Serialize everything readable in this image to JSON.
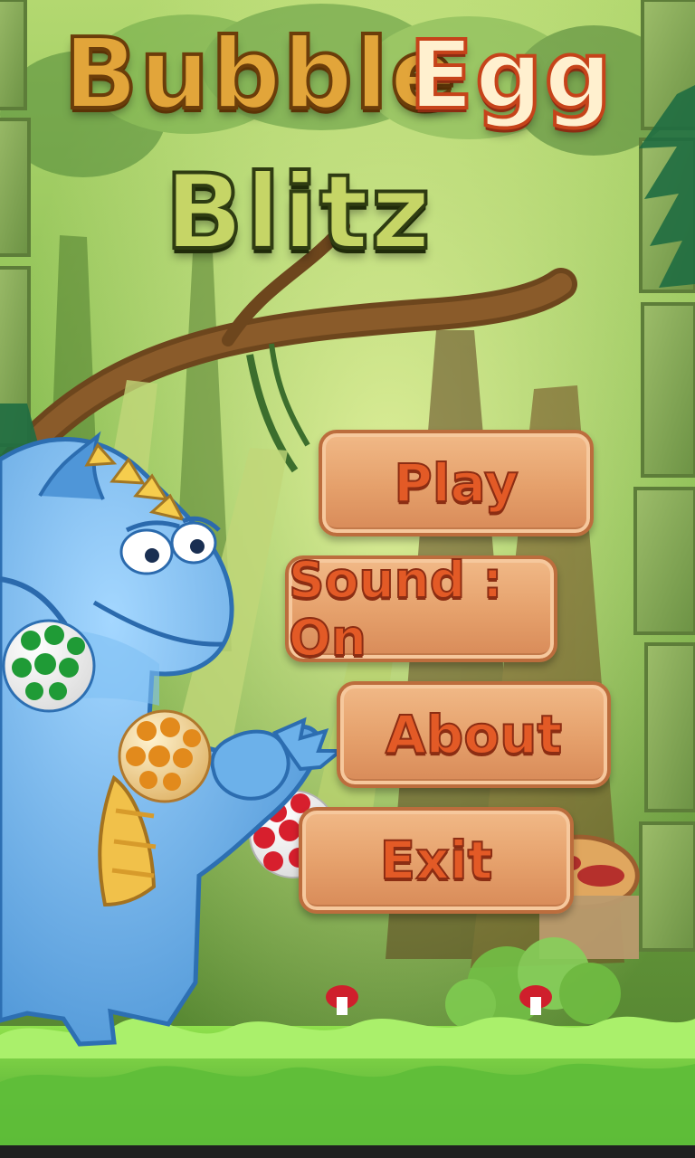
{
  "title": {
    "bubble": "Bubble",
    "egg": "Egg",
    "blitz": "Blitz"
  },
  "menu": {
    "play": "Play",
    "sound": "Sound : On",
    "about": "About",
    "exit": "Exit"
  },
  "colors": {
    "jungle_green": "#5f9233",
    "button_orange": "#e5a06b",
    "button_text": "#e35a26",
    "dragon_blue": "#62a9e8",
    "grass_green": "#61c23b"
  },
  "icons": {
    "green_egg": "green-spotted-egg-icon",
    "orange_egg": "orange-spotted-egg-icon",
    "red_egg": "red-spotted-egg-icon",
    "mushroom": "mushroom-icon",
    "dragon": "dragon-character"
  }
}
